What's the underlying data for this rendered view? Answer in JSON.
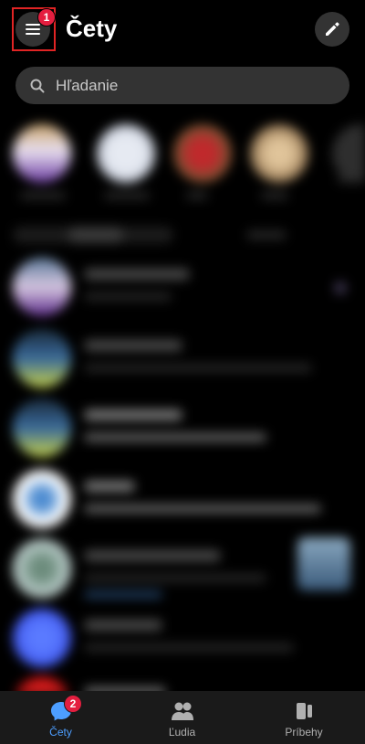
{
  "header": {
    "title": "Čety",
    "menu_badge": "1",
    "menu_icon": "hamburger-icon",
    "compose_icon": "pencil-icon"
  },
  "search": {
    "placeholder": "Hľadanie",
    "icon": "search-icon"
  },
  "bottom_nav": {
    "items": [
      {
        "label": "Čety",
        "icon": "chat-bubble-icon",
        "badge": "2",
        "active": true
      },
      {
        "label": "Ľudia",
        "icon": "people-icon",
        "active": false
      },
      {
        "label": "Príbehy",
        "icon": "stories-icon",
        "active": false
      }
    ]
  },
  "colors": {
    "background": "#000000",
    "surface": "#333333",
    "accent": "#4d9eff",
    "badge": "#e41e3f",
    "highlight_border": "#e02424",
    "inactive_nav": "#b0b0b0"
  }
}
